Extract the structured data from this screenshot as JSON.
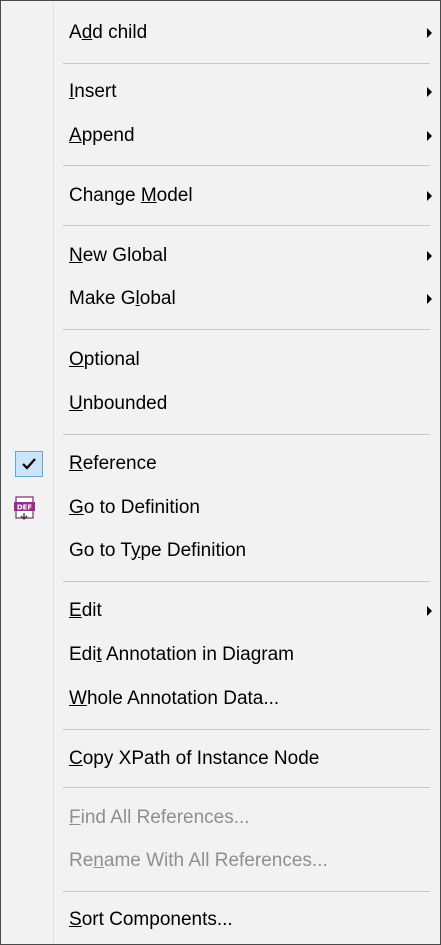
{
  "menu": {
    "items": [
      {
        "label": "Add child",
        "mnemonic": "d",
        "mnemonic_index": 1,
        "has_submenu": true,
        "disabled": false
      },
      {
        "label": "Insert",
        "mnemonic": "I",
        "mnemonic_index": 0,
        "has_submenu": true,
        "disabled": false
      },
      {
        "label": "Append",
        "mnemonic": "A",
        "mnemonic_index": 0,
        "has_submenu": true,
        "disabled": false
      },
      {
        "label": "Change Model",
        "mnemonic": "M",
        "mnemonic_index": 7,
        "has_submenu": true,
        "disabled": false
      },
      {
        "label": "New Global",
        "mnemonic": "N",
        "mnemonic_index": 0,
        "has_submenu": true,
        "disabled": false
      },
      {
        "label": "Make Global",
        "mnemonic": "l",
        "mnemonic_index": 6,
        "has_submenu": true,
        "disabled": false
      },
      {
        "label": "Optional",
        "mnemonic": "O",
        "mnemonic_index": 0,
        "has_submenu": false,
        "disabled": false
      },
      {
        "label": "Unbounded",
        "mnemonic": "U",
        "mnemonic_index": 0,
        "has_submenu": false,
        "disabled": false
      },
      {
        "label": "Reference",
        "mnemonic": "R",
        "mnemonic_index": 0,
        "has_submenu": false,
        "disabled": false,
        "checked": true
      },
      {
        "label": "Go to Definition",
        "mnemonic": "G",
        "mnemonic_index": 0,
        "has_submenu": false,
        "disabled": false,
        "icon": "go-to-definition-icon"
      },
      {
        "label": "Go to Type Definition",
        "mnemonic": "y",
        "mnemonic_index": 7,
        "has_submenu": false,
        "disabled": false
      },
      {
        "label": "Edit",
        "mnemonic": "E",
        "mnemonic_index": 0,
        "has_submenu": true,
        "disabled": false
      },
      {
        "label": "Edit Annotation in Diagram",
        "mnemonic": "t",
        "mnemonic_index": 3,
        "has_submenu": false,
        "disabled": false
      },
      {
        "label": "Whole Annotation Data...",
        "mnemonic": "W",
        "mnemonic_index": 0,
        "has_submenu": false,
        "disabled": false
      },
      {
        "label": "Copy XPath of Instance Node",
        "mnemonic": "C",
        "mnemonic_index": 0,
        "has_submenu": false,
        "disabled": false
      },
      {
        "label": "Find All References...",
        "mnemonic": "F",
        "mnemonic_index": 0,
        "has_submenu": false,
        "disabled": true
      },
      {
        "label": "Rename With All References...",
        "mnemonic": "n",
        "mnemonic_index": 2,
        "has_submenu": false,
        "disabled": true
      },
      {
        "label": "Sort Components...",
        "mnemonic": "S",
        "mnemonic_index": 0,
        "has_submenu": false,
        "disabled": false
      }
    ]
  },
  "icons": {
    "check": "checkmark-icon",
    "definition": "go-to-definition-icon",
    "submenu": "submenu-arrow-icon"
  },
  "colors": {
    "background": "#f2f2f2",
    "text": "#000000",
    "disabled_text": "#8f8f8f",
    "separator": "#c8c8c8",
    "check_highlight": "#cce4f7",
    "check_border": "#5ca8e0",
    "def_icon": "#9b2a8c"
  }
}
